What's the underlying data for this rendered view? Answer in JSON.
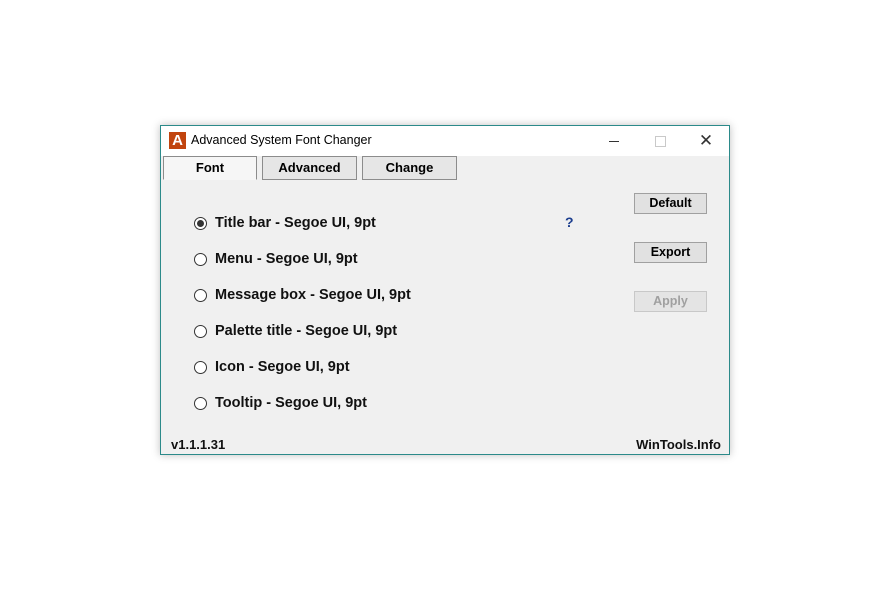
{
  "window": {
    "title": "Advanced System Font Changer",
    "icon_letter": "A",
    "controls": {
      "minimize": "minimize-icon",
      "maximize": "maximize-icon",
      "close": "close-icon",
      "close_glyph": "✕"
    }
  },
  "tabs": [
    {
      "label": "Font",
      "active": true
    },
    {
      "label": "Advanced",
      "active": false
    },
    {
      "label": "Change",
      "active": false
    }
  ],
  "font_items": [
    {
      "label": "Title bar - Segoe UI, 9pt",
      "selected": true
    },
    {
      "label": "Menu - Segoe UI, 9pt",
      "selected": false
    },
    {
      "label": "Message box - Segoe UI, 9pt",
      "selected": false
    },
    {
      "label": "Palette title - Segoe UI, 9pt",
      "selected": false
    },
    {
      "label": "Icon - Segoe UI, 9pt",
      "selected": false
    },
    {
      "label": "Tooltip - Segoe UI, 9pt",
      "selected": false
    }
  ],
  "help": {
    "label": "?"
  },
  "buttons": {
    "default": "Default",
    "export": "Export",
    "apply": "Apply"
  },
  "footer": {
    "version": "v1.1.1.31",
    "link": "WinTools.Info"
  },
  "colors": {
    "accent": "#c1440e",
    "border": "#2b8a8a",
    "help": "#1d3f8f"
  }
}
